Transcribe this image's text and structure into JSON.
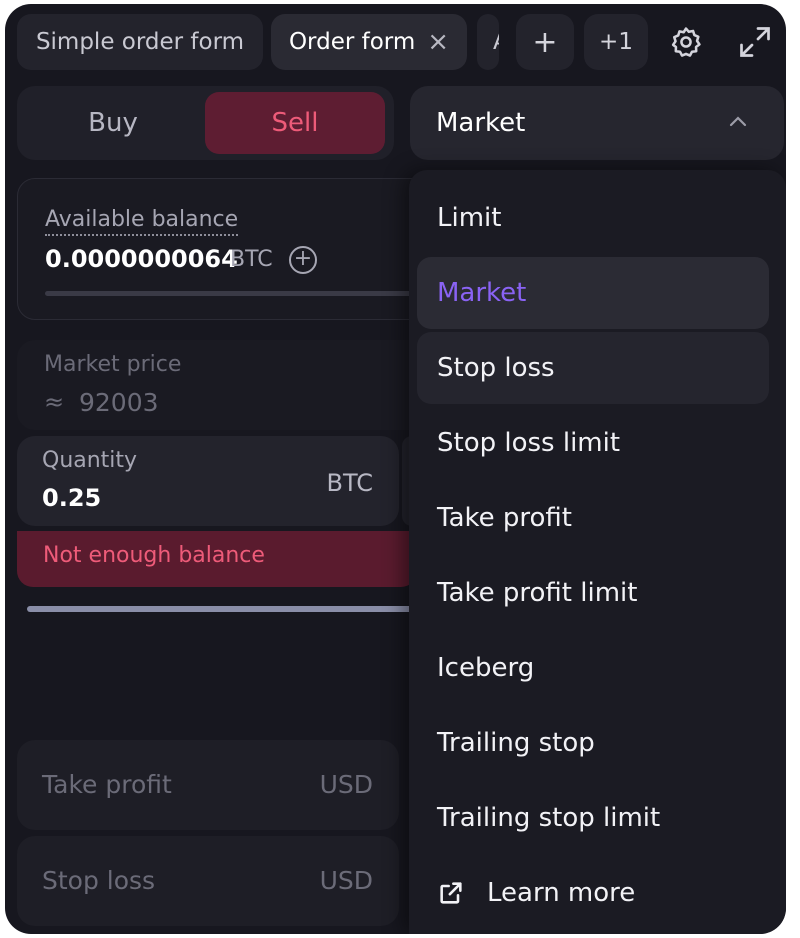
{
  "tabs": [
    {
      "label": "Simple order form",
      "active": false
    },
    {
      "label": "Order form",
      "active": true
    },
    {
      "label": "A",
      "active": false
    }
  ],
  "toolbar": {
    "add_label": "+",
    "overflow_label": "+1"
  },
  "side": {
    "buy_label": "Buy",
    "sell_label": "Sell",
    "selected": "Sell"
  },
  "order_type": {
    "selected": "Market"
  },
  "balance": {
    "label": "Available balance",
    "value": "0.0000000064",
    "unit": "BTC"
  },
  "market_price": {
    "label": "Market price",
    "approx": "≈",
    "value": "92003"
  },
  "quantity": {
    "label": "Quantity",
    "value": "0.25",
    "unit": "BTC"
  },
  "error": {
    "message": "Not enough balance"
  },
  "take_profit": {
    "label": "Take profit",
    "unit": "USD"
  },
  "stop_loss": {
    "label": "Stop loss",
    "unit": "USD"
  },
  "menu": {
    "items": [
      {
        "label": "Limit"
      },
      {
        "label": "Market"
      },
      {
        "label": "Stop loss"
      },
      {
        "label": "Stop loss limit"
      },
      {
        "label": "Take profit"
      },
      {
        "label": "Take profit limit"
      },
      {
        "label": "Iceberg"
      },
      {
        "label": "Trailing stop"
      },
      {
        "label": "Trailing stop limit"
      }
    ],
    "learn_more": "Learn more"
  },
  "colors": {
    "background": "#17171f",
    "accent_purple": "#8a63f4",
    "sell_red": "#ee5b79",
    "error_bg": "#5a1b2e"
  }
}
